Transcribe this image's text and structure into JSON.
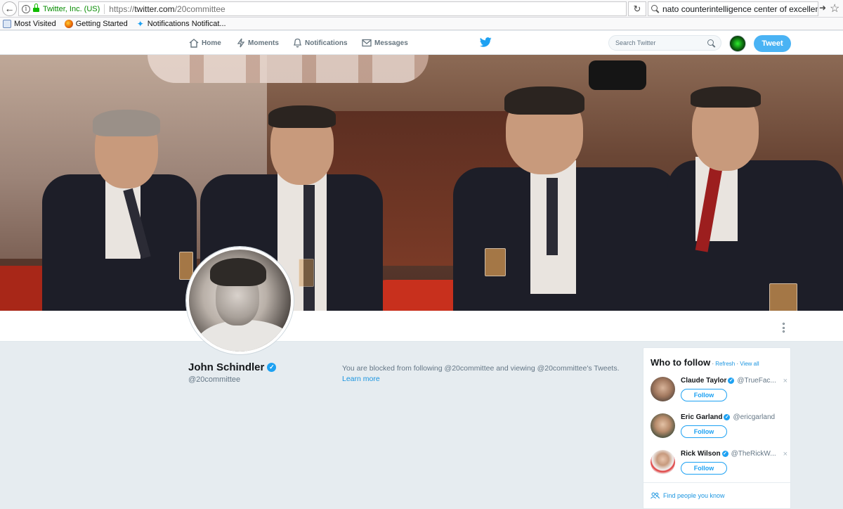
{
  "browser": {
    "identity": "Twitter, Inc. (US)",
    "url_scheme": "https://",
    "url_host": "twitter.com",
    "url_path": "/20committee",
    "search_value": "nato counterintelligence center of excellence",
    "bookmarks": [
      "Most Visited",
      "Getting Started",
      "Notifications Notificat..."
    ]
  },
  "nav": {
    "home": "Home",
    "moments": "Moments",
    "notifications": "Notifications",
    "messages": "Messages",
    "search_placeholder": "Search Twitter",
    "tweet_button": "Tweet"
  },
  "profile": {
    "name": "John Schindler",
    "handle": "@20committee",
    "blocked_text": "You are blocked from following @20committee and viewing @20committee's Tweets.",
    "learn_more": "Learn more"
  },
  "who_to_follow": {
    "title": "Who to follow",
    "refresh": "Refresh",
    "view_all": "View all",
    "users": [
      {
        "name": "Claude Taylor",
        "handle": "@TrueFac...",
        "follow": "Follow"
      },
      {
        "name": "Eric Garland",
        "handle": "@ericgarland",
        "follow": "Follow"
      },
      {
        "name": "Rick Wilson",
        "handle": "@TheRickW...",
        "follow": "Follow"
      }
    ],
    "find_people": "Find people you know"
  },
  "colors": {
    "twitter_blue": "#1da1f2",
    "tweet_button": "#4ab3f4",
    "page_bg": "#e6ecf0"
  }
}
